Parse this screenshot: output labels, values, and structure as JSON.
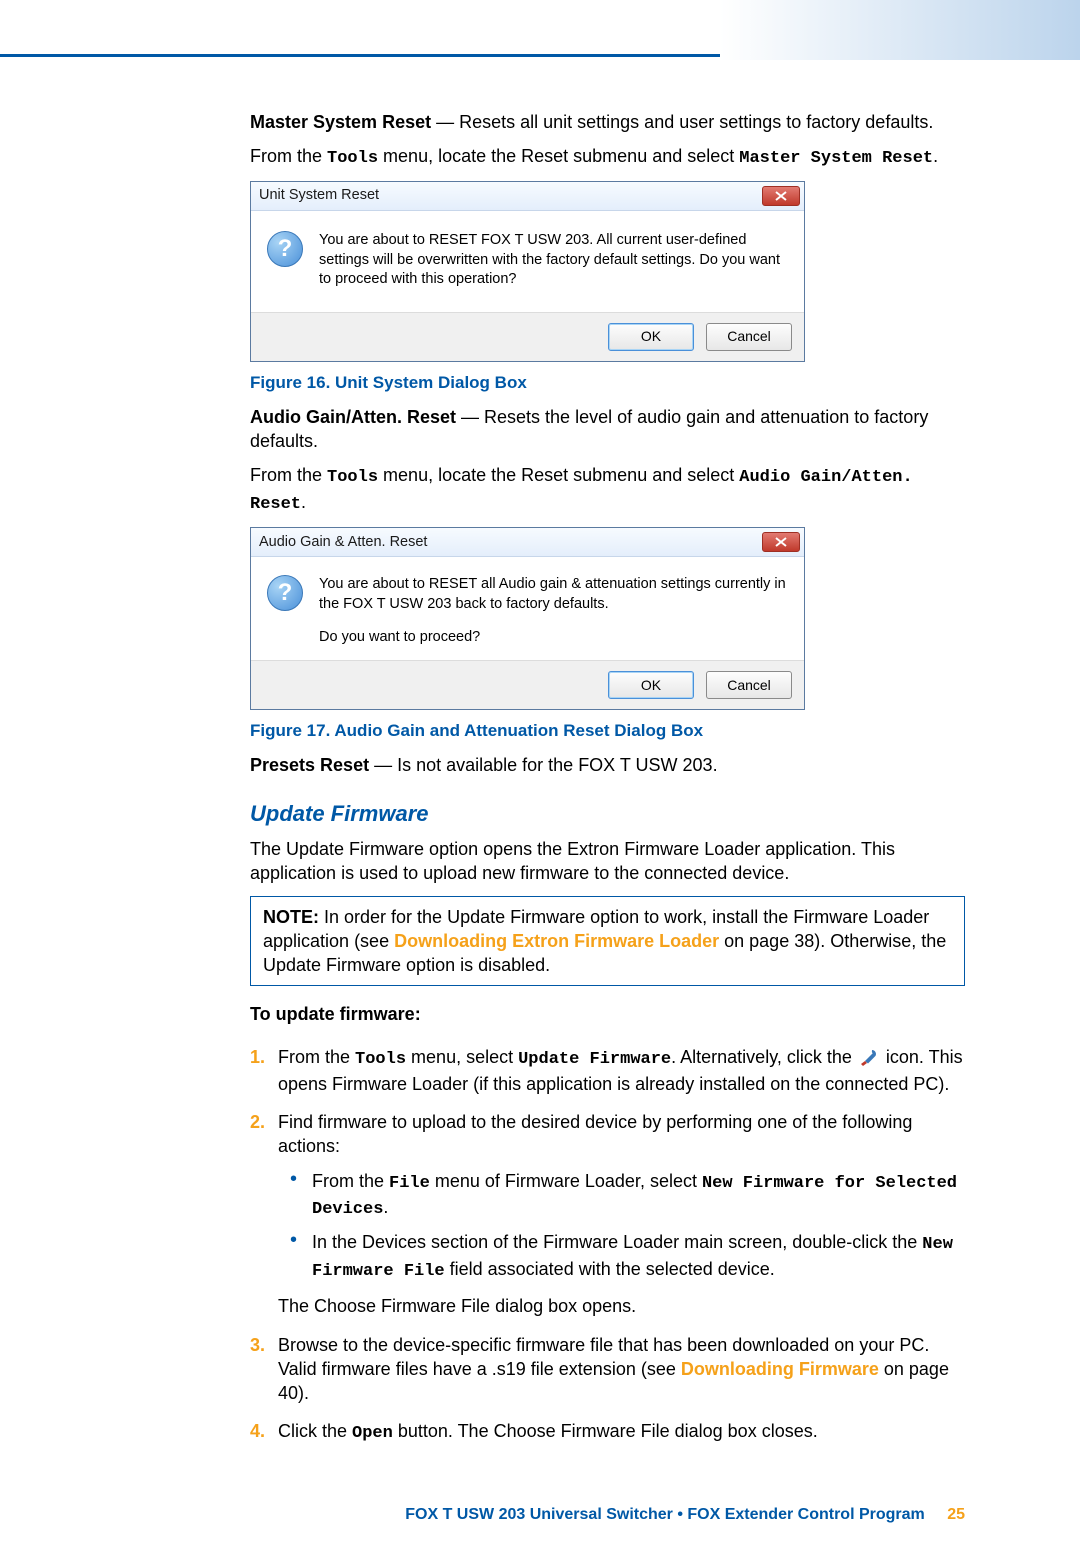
{
  "para1": {
    "lead": "Master System Reset",
    "text": " — Resets all unit settings and user settings to factory defaults."
  },
  "para2": {
    "pre": "From the ",
    "m1": "Tools",
    "mid": " menu, locate the Reset submenu and select ",
    "m2": "Master System Reset",
    "post": "."
  },
  "dialog1": {
    "title": "Unit System Reset",
    "msg": "You are about to RESET FOX T USW 203. All current user-defined settings will be overwritten with the factory default settings. Do you want to proceed with this operation?",
    "ok": "OK",
    "cancel": "Cancel"
  },
  "caption1": "Figure 16.   Unit System Dialog Box",
  "para3": {
    "lead": "Audio Gain/Atten. Reset",
    "text": " — Resets the level of audio gain and attenuation to factory defaults."
  },
  "para4": {
    "pre": "From the ",
    "m1": "Tools",
    "mid": " menu, locate the Reset submenu and select ",
    "m2": "Audio Gain/Atten. Reset",
    "post": "."
  },
  "dialog2": {
    "title": "Audio Gain & Atten. Reset",
    "msg1": "You are about to RESET all Audio gain & attenuation settings currently in the FOX T USW 203 back to factory defaults.",
    "msg2": "Do you want to proceed?",
    "ok": "OK",
    "cancel": "Cancel"
  },
  "caption2": "Figure 17.   Audio Gain and Attenuation Reset Dialog Box",
  "para5": {
    "lead": "Presets Reset",
    "text": " — Is not available for the FOX T USW 203."
  },
  "section": "Update Firmware",
  "para6": "The Update Firmware option opens the Extron Firmware Loader application. This application is used to upload new firmware to the connected device.",
  "note": {
    "lead": "NOTE:",
    "pre": "   In order for the Update Firmware option to work, install the Firmware Loader application (see ",
    "link": "Downloading Extron Firmware Loader",
    "post": " on page 38). Otherwise, the Update Firmware option is disabled."
  },
  "subhead": "To update firmware:",
  "steps": {
    "s1": {
      "num": "1.",
      "pre": "From the ",
      "m1": "Tools",
      "mid1": " menu, select ",
      "m2": "Update Firmware",
      "mid2": ". Alternatively, click the ",
      "post": " icon. This opens Firmware Loader (if this application is already installed on the connected PC)."
    },
    "s2": {
      "num": "2.",
      "text": "Find firmware to upload to the desired device by performing one of the following actions:",
      "b1": {
        "pre": "From the ",
        "m1": "File",
        "mid": " menu of Firmware Loader, select ",
        "m2": "New Firmware for Selected Devices",
        "post": "."
      },
      "b2": {
        "pre": "In the Devices section of the Firmware Loader main screen, double-click the ",
        "m1": "New Firmware File",
        "post": " field associated with the selected device."
      },
      "after": "The Choose Firmware File dialog box opens."
    },
    "s3": {
      "num": "3.",
      "pre": "Browse to the device-specific firmware file that has been downloaded on your PC. Valid firmware files have a .s19 file extension (see ",
      "link": "Downloading Firmware",
      "post": " on page 40)."
    },
    "s4": {
      "num": "4.",
      "pre": "Click the ",
      "m1": "Open",
      "post": " button. The Choose Firmware File dialog box closes."
    }
  },
  "footer": {
    "text": "FOX T USW 203 Universal Switcher • FOX Extender Control Program",
    "page": "25"
  }
}
